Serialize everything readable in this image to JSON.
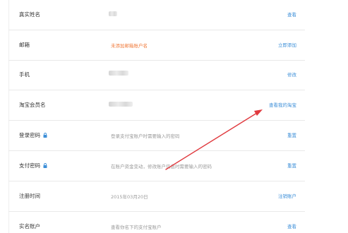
{
  "rows": [
    {
      "label": "真实姓名",
      "value": "",
      "action": "查看"
    },
    {
      "label": "邮箱",
      "value": "未添加邮箱账户名",
      "action": "立即添加"
    },
    {
      "label": "手机",
      "value": "",
      "action": "修改"
    },
    {
      "label": "淘宝会员名",
      "value": "",
      "action": "查看我的淘宝"
    },
    {
      "label": "登录密码",
      "value": "登录支付宝账户时需要输入的密码",
      "action": "重置"
    },
    {
      "label": "支付密码",
      "value": "在账户资金变动，修改账户信息时需要输入的密码",
      "action": "重置"
    },
    {
      "label": "注册时间",
      "value": "2015年03月20日",
      "action": "注销账户"
    },
    {
      "label": "实名账户",
      "value": "查看你名下的支付宝账户",
      "action": "查看"
    }
  ],
  "colors": {
    "link": "#3d8fd8",
    "warning": "#f07a3a",
    "arrow": "#e0393e"
  },
  "icons": {
    "lock": "lock-icon"
  }
}
